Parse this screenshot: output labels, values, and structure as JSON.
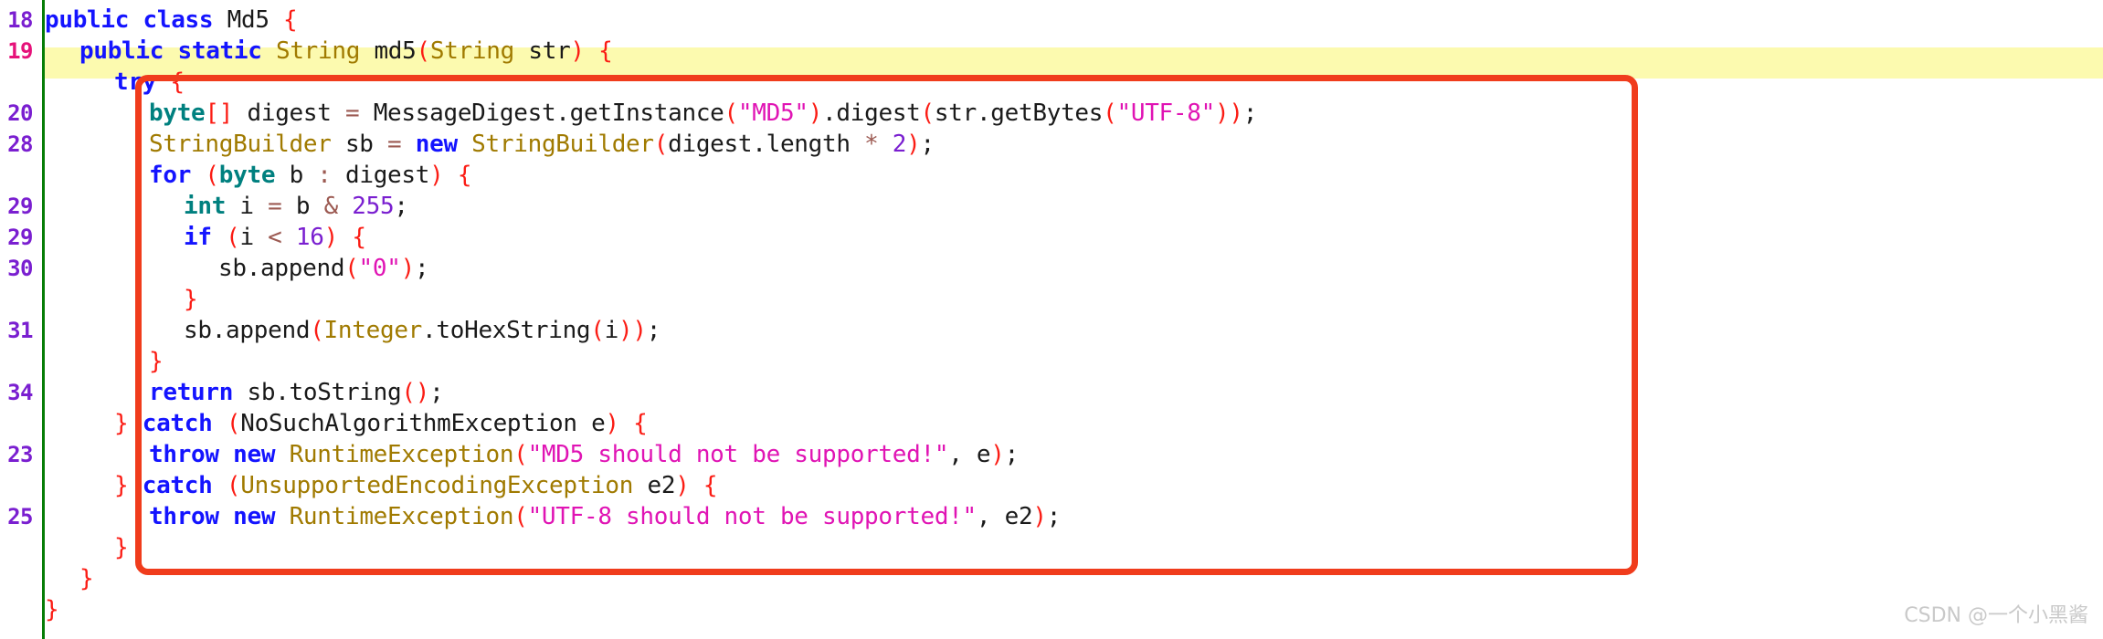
{
  "editor": {
    "background": "#ffffff",
    "gutter_rule_color": "#067d06",
    "current_line_highlight_color": "#fcfaaf",
    "line_number_color": "#7a1fd0",
    "current_line_number_color": "#e6127a",
    "annotation_box_color": "#f03c1c",
    "language": "Java"
  },
  "gutter": {
    "line_numbers": [
      {
        "label": "18",
        "current": false
      },
      {
        "label": "19",
        "current": true
      },
      {
        "label": "",
        "current": false
      },
      {
        "label": "20",
        "current": false
      },
      {
        "label": "28",
        "current": false
      },
      {
        "label": "",
        "current": false
      },
      {
        "label": "29",
        "current": false
      },
      {
        "label": "29",
        "current": false
      },
      {
        "label": "30",
        "current": false
      },
      {
        "label": "",
        "current": false
      },
      {
        "label": "31",
        "current": false
      },
      {
        "label": "",
        "current": false
      },
      {
        "label": "34",
        "current": false
      },
      {
        "label": "",
        "current": false
      },
      {
        "label": "23",
        "current": false
      },
      {
        "label": "",
        "current": false
      },
      {
        "label": "25",
        "current": false
      },
      {
        "label": "",
        "current": false
      },
      {
        "label": "",
        "current": false
      },
      {
        "label": "",
        "current": false
      }
    ]
  },
  "code": {
    "lines": [
      {
        "indent": 0,
        "tokens": [
          {
            "t": "public",
            "c": "kw"
          },
          {
            "t": " ",
            "c": "pln"
          },
          {
            "t": "class",
            "c": "kw"
          },
          {
            "t": " ",
            "c": "pln"
          },
          {
            "t": "Md5",
            "c": "pln"
          },
          {
            "t": " ",
            "c": "pln"
          },
          {
            "t": "{",
            "c": "punc"
          }
        ]
      },
      {
        "indent": 1,
        "tokens": [
          {
            "t": "public",
            "c": "kw"
          },
          {
            "t": " ",
            "c": "pln"
          },
          {
            "t": "static",
            "c": "kw"
          },
          {
            "t": " ",
            "c": "pln"
          },
          {
            "t": "String",
            "c": "cls"
          },
          {
            "t": " ",
            "c": "pln"
          },
          {
            "t": "md5",
            "c": "pln"
          },
          {
            "t": "(",
            "c": "punc"
          },
          {
            "t": "String",
            "c": "cls"
          },
          {
            "t": " ",
            "c": "pln"
          },
          {
            "t": "str",
            "c": "pln"
          },
          {
            "t": ")",
            "c": "punc"
          },
          {
            "t": " ",
            "c": "pln"
          },
          {
            "t": "{",
            "c": "punc"
          }
        ]
      },
      {
        "indent": 2,
        "tokens": [
          {
            "t": "try",
            "c": "kw"
          },
          {
            "t": " ",
            "c": "pln"
          },
          {
            "t": "{",
            "c": "punc"
          }
        ]
      },
      {
        "indent": 3,
        "tokens": [
          {
            "t": "byte",
            "c": "prim"
          },
          {
            "t": "[]",
            "c": "punc"
          },
          {
            "t": " ",
            "c": "pln"
          },
          {
            "t": "digest",
            "c": "pln"
          },
          {
            "t": " ",
            "c": "pln"
          },
          {
            "t": "=",
            "c": "op"
          },
          {
            "t": " ",
            "c": "pln"
          },
          {
            "t": "MessageDigest.getInstance",
            "c": "pln"
          },
          {
            "t": "(",
            "c": "punc"
          },
          {
            "t": "\"MD5\"",
            "c": "str"
          },
          {
            "t": ")",
            "c": "punc"
          },
          {
            "t": ".digest",
            "c": "pln"
          },
          {
            "t": "(",
            "c": "punc"
          },
          {
            "t": "str.getBytes",
            "c": "pln"
          },
          {
            "t": "(",
            "c": "punc"
          },
          {
            "t": "\"UTF-8\"",
            "c": "str"
          },
          {
            "t": "))",
            "c": "punc"
          },
          {
            "t": ";",
            "c": "semi"
          }
        ]
      },
      {
        "indent": 3,
        "tokens": [
          {
            "t": "StringBuilder",
            "c": "cls"
          },
          {
            "t": " ",
            "c": "pln"
          },
          {
            "t": "sb",
            "c": "pln"
          },
          {
            "t": " ",
            "c": "pln"
          },
          {
            "t": "=",
            "c": "op"
          },
          {
            "t": " ",
            "c": "pln"
          },
          {
            "t": "new",
            "c": "kw"
          },
          {
            "t": " ",
            "c": "pln"
          },
          {
            "t": "StringBuilder",
            "c": "cls"
          },
          {
            "t": "(",
            "c": "punc"
          },
          {
            "t": "digest.length",
            "c": "pln"
          },
          {
            "t": " ",
            "c": "pln"
          },
          {
            "t": "*",
            "c": "op"
          },
          {
            "t": " ",
            "c": "pln"
          },
          {
            "t": "2",
            "c": "num"
          },
          {
            "t": ")",
            "c": "punc"
          },
          {
            "t": ";",
            "c": "semi"
          }
        ]
      },
      {
        "indent": 3,
        "tokens": [
          {
            "t": "for",
            "c": "kw"
          },
          {
            "t": " ",
            "c": "pln"
          },
          {
            "t": "(",
            "c": "punc"
          },
          {
            "t": "byte",
            "c": "prim"
          },
          {
            "t": " ",
            "c": "pln"
          },
          {
            "t": "b",
            "c": "pln"
          },
          {
            "t": " ",
            "c": "pln"
          },
          {
            "t": ":",
            "c": "op"
          },
          {
            "t": " ",
            "c": "pln"
          },
          {
            "t": "digest",
            "c": "pln"
          },
          {
            "t": ")",
            "c": "punc"
          },
          {
            "t": " ",
            "c": "pln"
          },
          {
            "t": "{",
            "c": "punc"
          }
        ]
      },
      {
        "indent": 4,
        "tokens": [
          {
            "t": "int",
            "c": "prim"
          },
          {
            "t": " ",
            "c": "pln"
          },
          {
            "t": "i",
            "c": "pln"
          },
          {
            "t": " ",
            "c": "pln"
          },
          {
            "t": "=",
            "c": "op"
          },
          {
            "t": " ",
            "c": "pln"
          },
          {
            "t": "b",
            "c": "pln"
          },
          {
            "t": " ",
            "c": "pln"
          },
          {
            "t": "&",
            "c": "op"
          },
          {
            "t": " ",
            "c": "pln"
          },
          {
            "t": "255",
            "c": "num"
          },
          {
            "t": ";",
            "c": "semi"
          }
        ]
      },
      {
        "indent": 4,
        "tokens": [
          {
            "t": "if",
            "c": "kw"
          },
          {
            "t": " ",
            "c": "pln"
          },
          {
            "t": "(",
            "c": "punc"
          },
          {
            "t": "i",
            "c": "pln"
          },
          {
            "t": " ",
            "c": "pln"
          },
          {
            "t": "<",
            "c": "op"
          },
          {
            "t": " ",
            "c": "pln"
          },
          {
            "t": "16",
            "c": "num"
          },
          {
            "t": ")",
            "c": "punc"
          },
          {
            "t": " ",
            "c": "pln"
          },
          {
            "t": "{",
            "c": "punc"
          }
        ]
      },
      {
        "indent": 5,
        "tokens": [
          {
            "t": "sb.append",
            "c": "pln"
          },
          {
            "t": "(",
            "c": "punc"
          },
          {
            "t": "\"0\"",
            "c": "str"
          },
          {
            "t": ")",
            "c": "punc"
          },
          {
            "t": ";",
            "c": "semi"
          }
        ]
      },
      {
        "indent": 4,
        "tokens": [
          {
            "t": "}",
            "c": "punc"
          }
        ]
      },
      {
        "indent": 4,
        "tokens": [
          {
            "t": "sb.append",
            "c": "pln"
          },
          {
            "t": "(",
            "c": "punc"
          },
          {
            "t": "Integer",
            "c": "cls"
          },
          {
            "t": ".toHexString",
            "c": "pln"
          },
          {
            "t": "(",
            "c": "punc"
          },
          {
            "t": "i",
            "c": "pln"
          },
          {
            "t": "))",
            "c": "punc"
          },
          {
            "t": ";",
            "c": "semi"
          }
        ]
      },
      {
        "indent": 3,
        "tokens": [
          {
            "t": "}",
            "c": "punc"
          }
        ]
      },
      {
        "indent": 3,
        "tokens": [
          {
            "t": "return",
            "c": "kw"
          },
          {
            "t": " ",
            "c": "pln"
          },
          {
            "t": "sb.toString",
            "c": "pln"
          },
          {
            "t": "()",
            "c": "punc"
          },
          {
            "t": ";",
            "c": "semi"
          }
        ]
      },
      {
        "indent": 2,
        "tokens": [
          {
            "t": "}",
            "c": "punc"
          },
          {
            "t": " ",
            "c": "pln"
          },
          {
            "t": "catch",
            "c": "kw"
          },
          {
            "t": " ",
            "c": "pln"
          },
          {
            "t": "(",
            "c": "punc"
          },
          {
            "t": "NoSuchAlgorithmException",
            "c": "pln"
          },
          {
            "t": " ",
            "c": "pln"
          },
          {
            "t": "e",
            "c": "pln"
          },
          {
            "t": ")",
            "c": "punc"
          },
          {
            "t": " ",
            "c": "pln"
          },
          {
            "t": "{",
            "c": "punc"
          }
        ]
      },
      {
        "indent": 3,
        "tokens": [
          {
            "t": "throw",
            "c": "kw"
          },
          {
            "t": " ",
            "c": "pln"
          },
          {
            "t": "new",
            "c": "kw"
          },
          {
            "t": " ",
            "c": "pln"
          },
          {
            "t": "RuntimeException",
            "c": "cls"
          },
          {
            "t": "(",
            "c": "punc"
          },
          {
            "t": "\"MD5 should not be supported!\"",
            "c": "str"
          },
          {
            "t": ",",
            "c": "semi"
          },
          {
            "t": " ",
            "c": "pln"
          },
          {
            "t": "e",
            "c": "pln"
          },
          {
            "t": ")",
            "c": "punc"
          },
          {
            "t": ";",
            "c": "semi"
          }
        ]
      },
      {
        "indent": 2,
        "tokens": [
          {
            "t": "}",
            "c": "punc"
          },
          {
            "t": " ",
            "c": "pln"
          },
          {
            "t": "catch",
            "c": "kw"
          },
          {
            "t": " ",
            "c": "pln"
          },
          {
            "t": "(",
            "c": "punc"
          },
          {
            "t": "UnsupportedEncodingException",
            "c": "cls"
          },
          {
            "t": " ",
            "c": "pln"
          },
          {
            "t": "e2",
            "c": "pln"
          },
          {
            "t": ")",
            "c": "punc"
          },
          {
            "t": " ",
            "c": "pln"
          },
          {
            "t": "{",
            "c": "punc"
          }
        ]
      },
      {
        "indent": 3,
        "tokens": [
          {
            "t": "throw",
            "c": "kw"
          },
          {
            "t": " ",
            "c": "pln"
          },
          {
            "t": "new",
            "c": "kw"
          },
          {
            "t": " ",
            "c": "pln"
          },
          {
            "t": "RuntimeException",
            "c": "cls"
          },
          {
            "t": "(",
            "c": "punc"
          },
          {
            "t": "\"UTF-8 should not be supported!\"",
            "c": "str"
          },
          {
            "t": ",",
            "c": "semi"
          },
          {
            "t": " ",
            "c": "pln"
          },
          {
            "t": "e2",
            "c": "pln"
          },
          {
            "t": ")",
            "c": "punc"
          },
          {
            "t": ";",
            "c": "semi"
          }
        ]
      },
      {
        "indent": 2,
        "tokens": [
          {
            "t": "}",
            "c": "punc"
          }
        ]
      },
      {
        "indent": 1,
        "tokens": [
          {
            "t": "}",
            "c": "punc"
          }
        ]
      },
      {
        "indent": 0,
        "tokens": [
          {
            "t": "}",
            "c": "punc"
          }
        ]
      }
    ]
  },
  "watermark": {
    "text": "CSDN @一个小黑酱"
  }
}
